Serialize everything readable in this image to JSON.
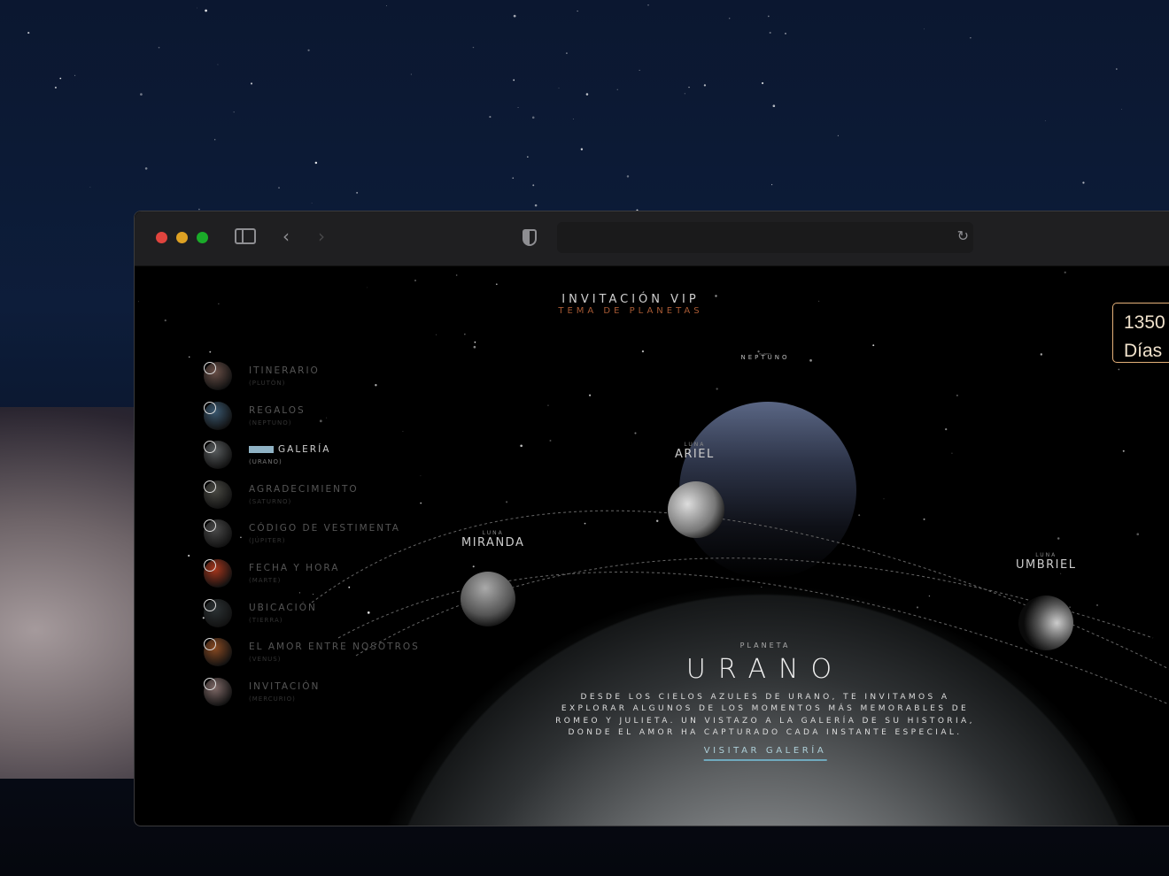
{
  "browser": {
    "traffic_lights": [
      "#e0443e",
      "#dea123",
      "#1aab29"
    ],
    "url": ""
  },
  "header": {
    "title": "INVITACIÓN VIP",
    "subtitle": "TEMA DE PLANETAS"
  },
  "days_counter": {
    "value": "1350",
    "unit": "Días"
  },
  "nav": [
    {
      "label": "ITINERARIO",
      "planet": "(PLUTÓN)",
      "color": "#6a5048"
    },
    {
      "label": "REGALOS",
      "planet": "(NEPTUNO)",
      "color": "#3a5870"
    },
    {
      "label": "GALERÍA",
      "planet": "(URANO)",
      "color": "#585c5e",
      "active": true
    },
    {
      "label": "AGRADECIMIENTO",
      "planet": "(SATURNO)",
      "color": "#4a4a44"
    },
    {
      "label": "CÓDIGO DE VESTIMENTA",
      "planet": "(JÚPITER)",
      "color": "#4a4a4a"
    },
    {
      "label": "FECHA Y HORA",
      "planet": "(MARTE)",
      "color": "#a8361c"
    },
    {
      "label": "UBICACIÓN",
      "planet": "(TIERRA)",
      "color": "#2c3234"
    },
    {
      "label": "EL AMOR ENTRE NOSOTROS",
      "planet": "(VENUS)",
      "color": "#8a4a22"
    },
    {
      "label": "INVITACIÓN",
      "planet": "(MERCURIO)",
      "color": "#806a68"
    }
  ],
  "neptune": {
    "small": "PLANETA",
    "name": "NEPTUNO"
  },
  "moons": [
    {
      "small": "LUNA",
      "name": "ARIEL"
    },
    {
      "small": "LUNA",
      "name": "MIRANDA"
    },
    {
      "small": "LUNA",
      "name": "UMBRIEL"
    }
  ],
  "planet": {
    "small": "PLANETA",
    "name": "URANO",
    "description": "DESDE LOS CIELOS AZULES DE URANO, TE INVITAMOS A EXPLORAR ALGUNOS DE LOS MOMENTOS MÁS MEMORABLES DE ROMEO Y JULIETA. UN VISTAZO A LA GALERÍA DE SU HISTORIA, DONDE EL AMOR HA CAPTURADO CADA INSTANTE ESPECIAL.",
    "cta": "VISITAR GALERÍA"
  }
}
